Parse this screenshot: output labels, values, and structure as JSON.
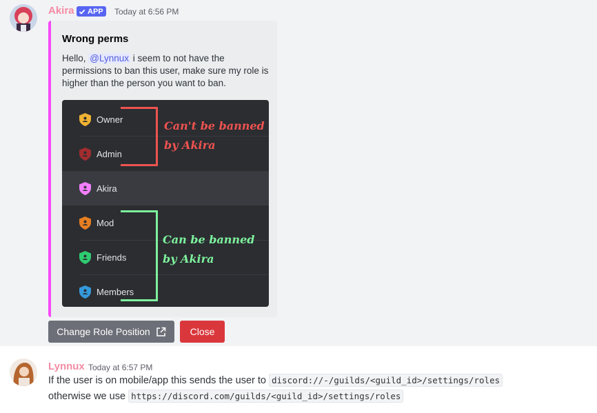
{
  "message1": {
    "author": "Akira",
    "author_color": "#f48ca4",
    "badge": "APP",
    "timestamp": "Today at 6:56 PM",
    "embed": {
      "accent_color": "#f84af8",
      "title": "Wrong perms",
      "desc_before": "Hello,",
      "mention": "@Lynnux",
      "desc_after": "i seem to not have the permissions to ban this user, make sure my role is higher than the person you want to ban.",
      "image": {
        "roles": [
          {
            "name": "Owner",
            "color": "#f0b232"
          },
          {
            "name": "Admin",
            "color": "#a12d2f"
          },
          {
            "name": "Akira",
            "color": "#f47fff"
          },
          {
            "name": "Mod",
            "color": "#e67e22"
          },
          {
            "name": "Friends",
            "color": "#2ecc71"
          },
          {
            "name": "Members",
            "color": "#3498db"
          }
        ],
        "note_top": [
          "Can't be banned",
          "by Akira"
        ],
        "note_top_color": "#ef5350",
        "note_bottom": [
          "Can be banned",
          "by Akira"
        ],
        "note_bottom_color": "#7ef29d"
      }
    },
    "buttons": {
      "change_role": "Change Role Position",
      "close": "Close"
    }
  },
  "message2": {
    "author": "Lynnux",
    "author_color": "#f48ca4",
    "timestamp": "Today at 6:57 PM",
    "line1_text": "If the user is on mobile/app this sends the user to",
    "line1_code": "discord://-/guilds/<guild_id>/settings/roles",
    "line2_text": "otherwise we use",
    "line2_code": "https://discord.com/guilds/<guild_id>/settings/roles"
  }
}
